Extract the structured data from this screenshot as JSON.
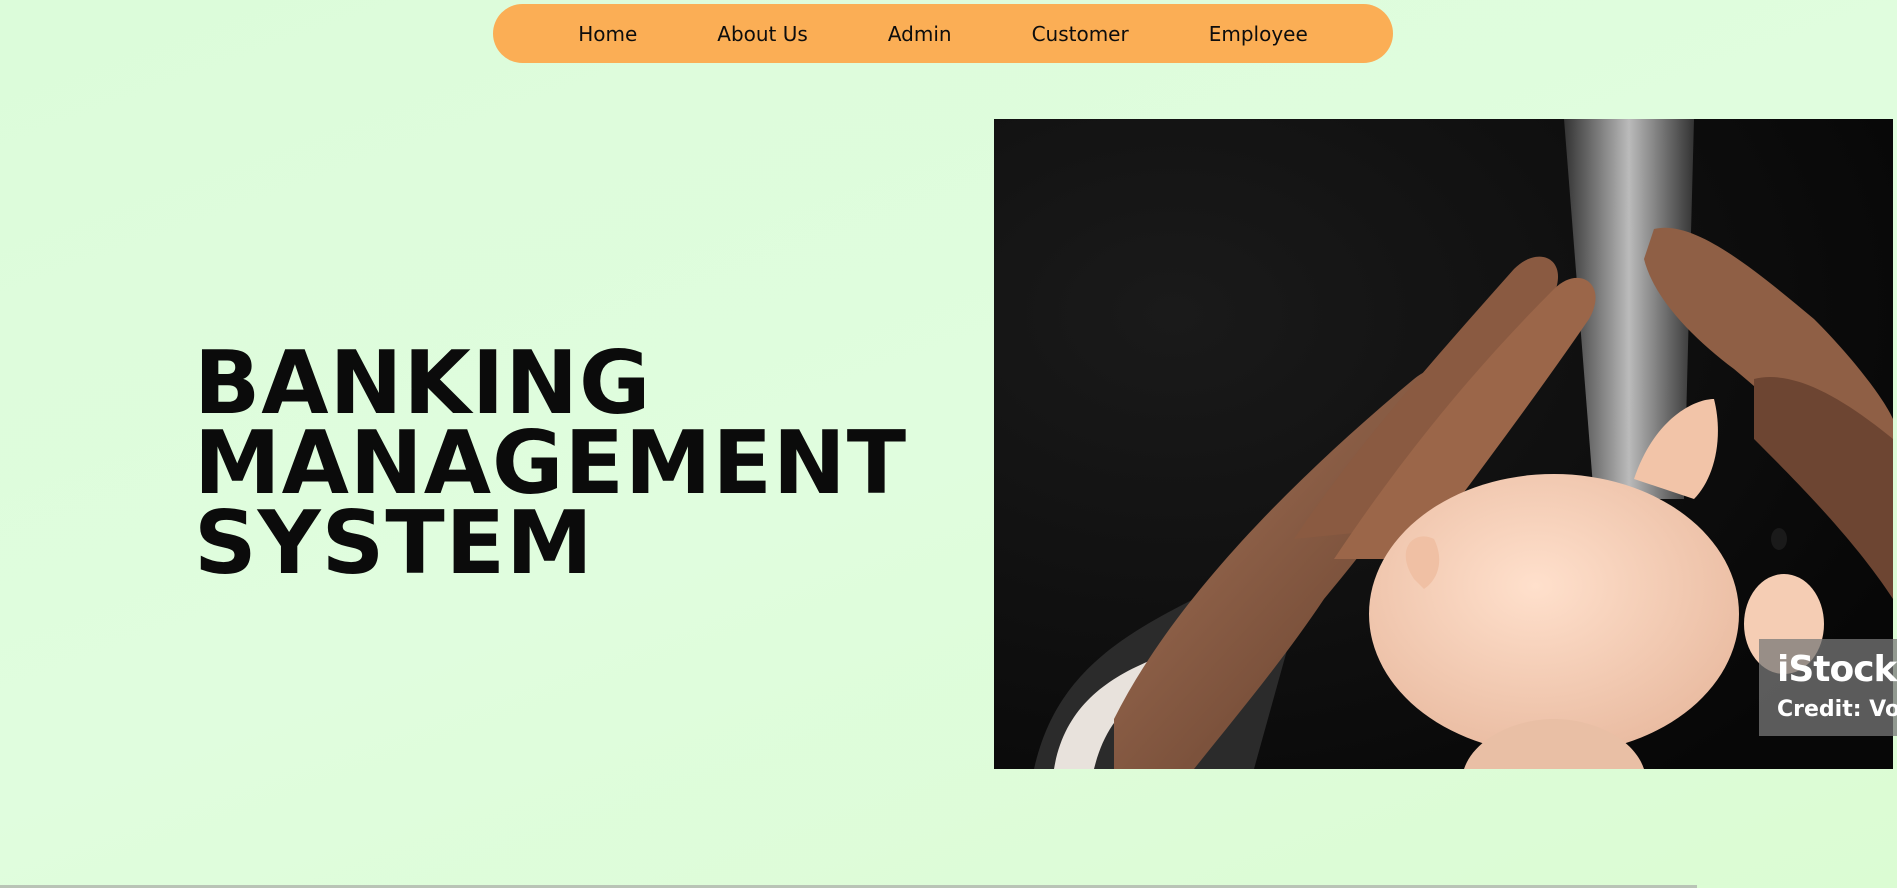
{
  "nav": {
    "items": [
      {
        "label": "Home"
      },
      {
        "label": "About Us"
      },
      {
        "label": "Admin"
      },
      {
        "label": "Customer"
      },
      {
        "label": "Employee"
      }
    ]
  },
  "hero": {
    "title_lines": [
      "BANKING",
      "MANAGEMENT",
      "SYSTEM"
    ]
  },
  "image": {
    "watermark_brand": "iStock",
    "watermark_credit": "Credit: Vo"
  },
  "colors": {
    "background": "#ddfdd9",
    "nav_bar": "#fbae55",
    "text": "#0b0b0b"
  }
}
